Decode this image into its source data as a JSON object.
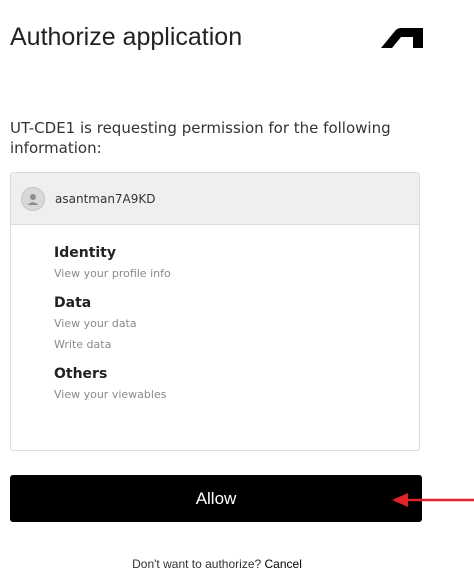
{
  "header": {
    "title": "Authorize application",
    "logo_icon": "autodesk-logo-icon"
  },
  "request": {
    "message": "UT-CDE1 is requesting permission for the following information:"
  },
  "account": {
    "avatar_icon": "user-avatar-icon",
    "username": "asantman7A9KD"
  },
  "permissions": [
    {
      "title": "Identity",
      "items": [
        "View your profile info"
      ]
    },
    {
      "title": "Data",
      "items": [
        "View your data",
        "Write data"
      ]
    },
    {
      "title": "Others",
      "items": [
        "View your viewables"
      ]
    }
  ],
  "actions": {
    "allow_label": "Allow",
    "decline_prompt": "Don't want to authorize?",
    "cancel_label": "Cancel"
  },
  "annotation": {
    "arrow_icon": "red-arrow-icon",
    "arrow_color": "#e0242b"
  },
  "colors": {
    "button_bg": "#000000",
    "button_text": "#ffffff",
    "card_header_bg": "#efefef"
  }
}
